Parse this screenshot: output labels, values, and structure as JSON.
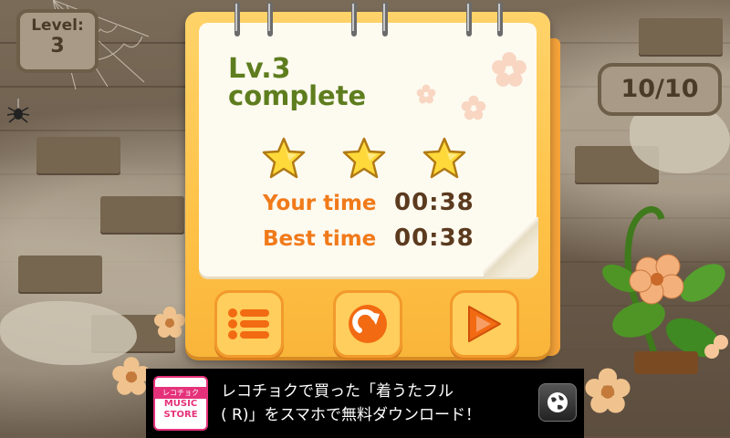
{
  "level_badge": {
    "label": "Level:",
    "value": "3"
  },
  "score_badge": {
    "value": "10/10"
  },
  "result": {
    "title_line1": "Lv.3",
    "title_line2": "complete",
    "stars_earned": 3,
    "stars_total": 3,
    "your_time_label": "Your time",
    "your_time_value": "00:38",
    "best_time_label": "Best time",
    "best_time_value": "00:38"
  },
  "buttons": {
    "menu": "list-menu-icon",
    "retry": "retry-arrow-icon",
    "next": "next-play-icon"
  },
  "ad": {
    "logo_top": "レコチョク",
    "logo_line1": "MUSIC",
    "logo_line2": "STORE",
    "text_line1": "レコチョクで買った「着うたフル",
    "text_line2": "( R)」をスマホで無料ダウンロード！",
    "globe_icon": "globe-icon"
  },
  "colors": {
    "title_green": "#5e7d1e",
    "label_orange": "#f07a1a",
    "value_brown": "#5b3a1e",
    "card_yellow": "#ffc247",
    "ad_pink": "#e5317a"
  }
}
